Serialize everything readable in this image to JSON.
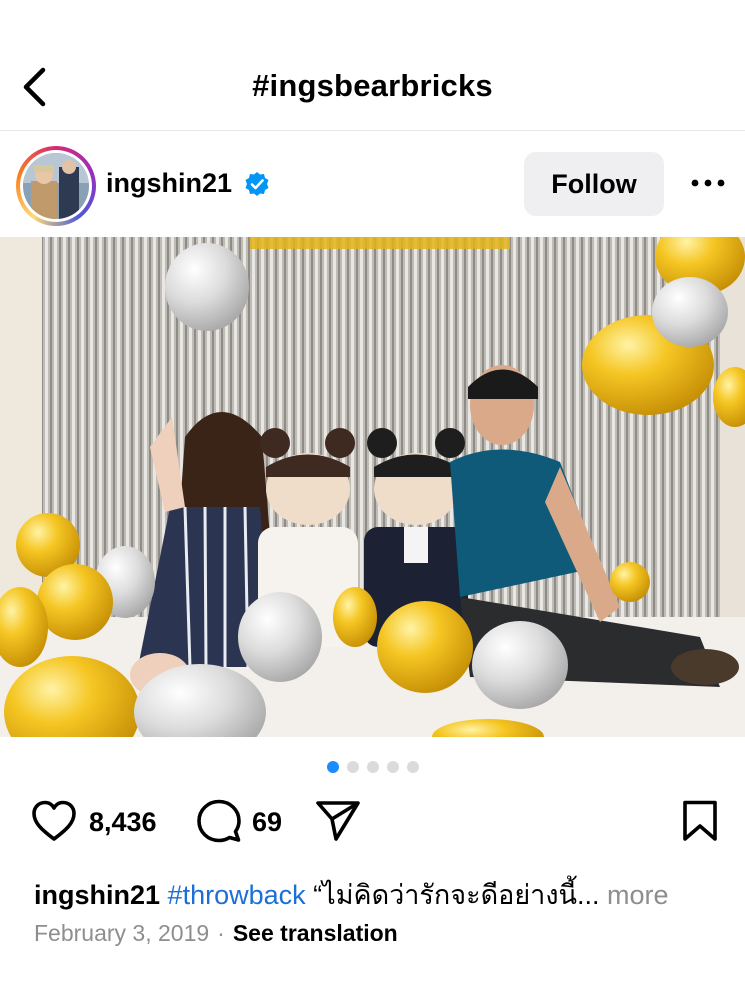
{
  "header": {
    "title": "#ingsbearbricks",
    "back_icon": "chevron-left-icon"
  },
  "post": {
    "username": "ingshin21",
    "verified": true,
    "follow_label": "Follow",
    "more_icon": "more-horizontal-icon"
  },
  "carousel": {
    "total": 5,
    "active_index": 0
  },
  "actions": {
    "likes": "8,436",
    "comments": "69",
    "like_icon": "heart-icon",
    "comment_icon": "comment-icon",
    "share_icon": "send-icon",
    "save_icon": "bookmark-icon"
  },
  "caption": {
    "username": "ingshin21",
    "hashtag": "#throwback",
    "text": "“ไม่คิดว่ารักจะดีอย่างนี้...",
    "more_label": "more"
  },
  "meta": {
    "date": "February 3, 2019",
    "separator": "·",
    "see_translation": "See translation"
  },
  "colors": {
    "link_blue": "#1b6fd6",
    "verified_blue": "#0095f6",
    "dot_active": "#1a8cff",
    "muted": "#8e8e8e",
    "button_bg": "#efeff1"
  }
}
